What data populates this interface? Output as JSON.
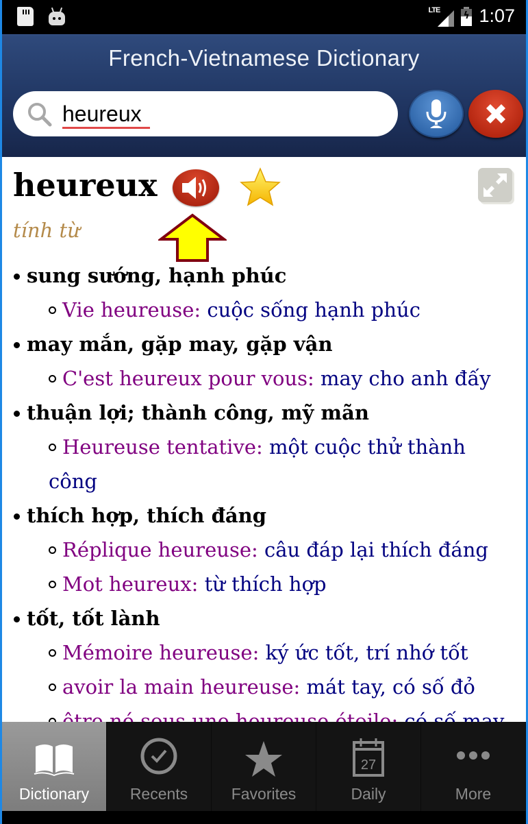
{
  "status_bar": {
    "network": "LTE",
    "time": "1:07"
  },
  "header": {
    "title": "French-Vietnamese Dictionary",
    "search": {
      "value": "heureux",
      "placeholder": ""
    }
  },
  "entry": {
    "headword": "heureux",
    "part_of_speech": "tính từ",
    "senses": [
      {
        "meaning": "sung sướng, hạnh phúc",
        "examples": [
          {
            "fr": "Vie heureuse:",
            "vi": " cuộc sống hạnh phúc"
          }
        ]
      },
      {
        "meaning": "may mắn, gặp may, gặp vận",
        "examples": [
          {
            "fr": "C'est heureux pour vous:",
            "vi": " may cho anh đấy"
          }
        ]
      },
      {
        "meaning": "thuận lợi; thành công, mỹ mãn",
        "examples": [
          {
            "fr": "Heureuse tentative:",
            "vi": " một cuộc thử thành",
            "vi_wrap": "công"
          }
        ]
      },
      {
        "meaning": "thích hợp, thích đáng",
        "examples": [
          {
            "fr": "Réplique heureuse:",
            "vi": " câu đáp lại thích đáng"
          },
          {
            "fr": "Mot heureux:",
            "vi": " từ thích hợp"
          }
        ]
      },
      {
        "meaning": "tốt, tốt lành",
        "examples": [
          {
            "fr": "Mémoire heureuse:",
            "vi": " ký ức tốt, trí nhớ tốt"
          },
          {
            "fr": "avoir la main heureuse:",
            "vi": " mát tay, có số đỏ"
          },
          {
            "fr": "être né sous une heureuse étoile:",
            "vi": " có số may"
          }
        ]
      }
    ]
  },
  "bottom_nav": {
    "items": [
      {
        "label": "Dictionary",
        "icon": "book-icon",
        "active": true
      },
      {
        "label": "Recents",
        "icon": "clock-check-icon",
        "active": false
      },
      {
        "label": "Favorites",
        "icon": "star-icon",
        "active": false
      },
      {
        "label": "Daily",
        "icon": "calendar-icon",
        "active": false,
        "badge": "27"
      },
      {
        "label": "More",
        "icon": "more-dots-icon",
        "active": false
      }
    ]
  },
  "colors": {
    "header_bg": "#1f3460",
    "french_example": "#800080",
    "vietnamese_translation": "#000080",
    "part_of_speech": "#b48a4a",
    "speaker_button": "#b3250f",
    "mic_button": "#2d64a8",
    "close_button": "#b3250f",
    "annotation_arrow_fill": "#ffff00",
    "annotation_arrow_border": "#800010"
  }
}
